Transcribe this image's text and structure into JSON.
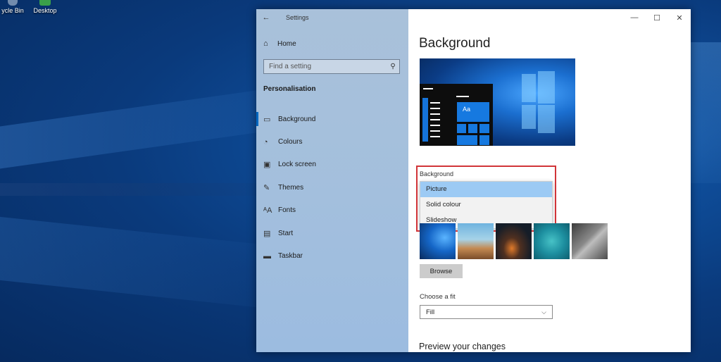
{
  "desktop": {
    "icons": [
      {
        "label": "ycle Bin"
      },
      {
        "label": "Desktop"
      }
    ]
  },
  "window": {
    "title": "Settings",
    "controls": {
      "minimize": "—",
      "maximize": "☐",
      "close": "✕"
    }
  },
  "sidebar": {
    "home": "Home",
    "search_placeholder": "Find a setting",
    "section": "Personalisation",
    "items": [
      {
        "label": "Background",
        "icon": "image-icon",
        "active": true
      },
      {
        "label": "Colours",
        "icon": "palette-icon"
      },
      {
        "label": "Lock screen",
        "icon": "lock-screen-icon"
      },
      {
        "label": "Themes",
        "icon": "brush-icon"
      },
      {
        "label": "Fonts",
        "icon": "font-icon"
      },
      {
        "label": "Start",
        "icon": "start-icon"
      },
      {
        "label": "Taskbar",
        "icon": "taskbar-icon"
      }
    ]
  },
  "main": {
    "title": "Background",
    "preview_tile_label": "Aa",
    "background_label": "Background",
    "background_options": [
      "Picture",
      "Solid colour",
      "Slideshow"
    ],
    "selected_option": "Picture",
    "browse_label": "Browse",
    "fit_label": "Choose a fit",
    "fit_value": "Fill",
    "preview_heading": "Preview your changes"
  },
  "colors": {
    "accent": "#0067c0",
    "highlight_box": "#d13438",
    "selected_option_bg": "#9ccaf4"
  }
}
